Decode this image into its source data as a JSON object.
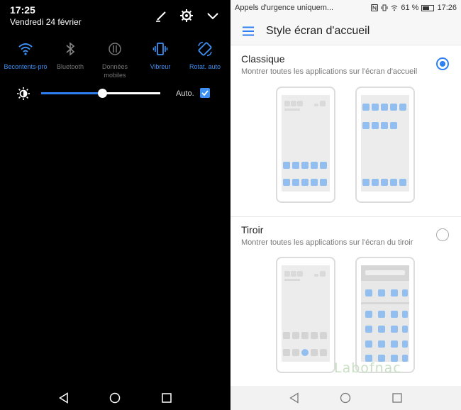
{
  "shade": {
    "time": "17:25",
    "date": "Vendredi 24 février",
    "header_icons": [
      "edit-icon",
      "gear-icon",
      "chevron-down-icon"
    ],
    "toggles": [
      {
        "label": "Becontents-pro",
        "icon": "wifi-icon",
        "state": "on"
      },
      {
        "label": "Bluetooth",
        "icon": "bluetooth-icon",
        "state": "off"
      },
      {
        "label": "Données mobiles",
        "icon": "mobile-data-icon",
        "state": "off"
      },
      {
        "label": "Vibreur",
        "icon": "vibrate-icon",
        "state": "on"
      },
      {
        "label": "Rotat. auto",
        "icon": "rotate-icon",
        "state": "on"
      }
    ],
    "brightness": {
      "level": 0.51,
      "auto_label": "Auto.",
      "auto_checked": true
    }
  },
  "status_bar": {
    "carrier": "Appels d'urgence uniquem...",
    "icons": [
      "nfc-icon",
      "vibrate-icon",
      "wifi-icon"
    ],
    "battery_pct": "61 %",
    "battery_level": 0.61,
    "time": "17:26"
  },
  "header": {
    "title": "Style écran d'accueil"
  },
  "options": [
    {
      "title": "Classique",
      "description": "Montrer toutes les applications sur l'écran d'accueil",
      "selected": true
    },
    {
      "title": "Tiroir",
      "description": "Montrer toutes les applications sur l'écran du tiroir",
      "selected": false
    }
  ],
  "watermark": "Labofnac",
  "colors": {
    "accent": "#2d7ff0",
    "shade_bg": "#000000",
    "icon_blue": "#93bff0"
  },
  "navigation": [
    "back-icon",
    "home-icon",
    "recents-icon"
  ]
}
